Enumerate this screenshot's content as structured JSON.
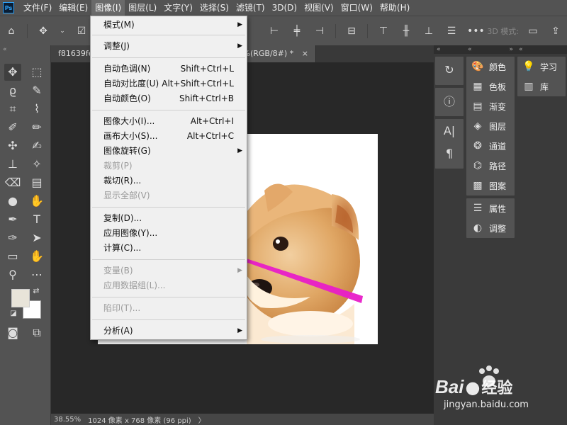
{
  "menubar": {
    "logo": "Ps",
    "items": [
      "文件(F)",
      "编辑(E)",
      "图像(I)",
      "图层(L)",
      "文字(Y)",
      "选择(S)",
      "滤镜(T)",
      "3D(D)",
      "视图(V)",
      "窗口(W)",
      "帮助(H)"
    ]
  },
  "options_bar": {
    "mode_label": "3D 模式:"
  },
  "tabs": [
    {
      "title": "f81639fe"
    },
    {
      "title": "%(RGB/8#) *"
    }
  ],
  "image_menu": {
    "sections": [
      [
        {
          "label": "模式(M)",
          "submenu": true
        },
        {
          "label": "调整(J)",
          "submenu": true
        }
      ],
      [
        {
          "label": "自动色调(N)",
          "shortcut": "Shift+Ctrl+L"
        },
        {
          "label": "自动对比度(U)",
          "shortcut": "Alt+Shift+Ctrl+L"
        },
        {
          "label": "自动颜色(O)",
          "shortcut": "Shift+Ctrl+B"
        }
      ],
      [
        {
          "label": "图像大小(I)...",
          "shortcut": "Alt+Ctrl+I"
        },
        {
          "label": "画布大小(S)...",
          "shortcut": "Alt+Ctrl+C"
        },
        {
          "label": "图像旋转(G)",
          "submenu": true
        },
        {
          "label": "裁剪(P)",
          "disabled": true
        },
        {
          "label": "裁切(R)..."
        },
        {
          "label": "显示全部(V)",
          "disabled": true
        }
      ],
      [
        {
          "label": "复制(D)..."
        },
        {
          "label": "应用图像(Y)..."
        },
        {
          "label": "计算(C)..."
        }
      ],
      [
        {
          "label": "变量(B)",
          "disabled": true,
          "submenu": true
        },
        {
          "label": "应用数据组(L)...",
          "disabled": true
        }
      ],
      [
        {
          "label": "陷印(T)...",
          "disabled": true
        }
      ],
      [
        {
          "label": "分析(A)",
          "submenu": true
        }
      ]
    ]
  },
  "status_bar": {
    "zoom": "38.55%",
    "doc_info": "1024 像素 x 768 像素 (96 ppi)",
    "arrow": "〉"
  },
  "panels_mid": [
    "颜色",
    "色板",
    "渐变",
    "图层",
    "通道",
    "路径",
    "图案",
    "属性",
    "调整"
  ],
  "panels_right": [
    "学习",
    "库"
  ],
  "watermark": {
    "brand": "Bai",
    "brand_suffix": "经验",
    "url": "jingyan.baidu.com"
  },
  "colors": {
    "arrow": "#e81ec8",
    "menu_bg": "#f0f0f0",
    "ui_panel": "#535353"
  }
}
